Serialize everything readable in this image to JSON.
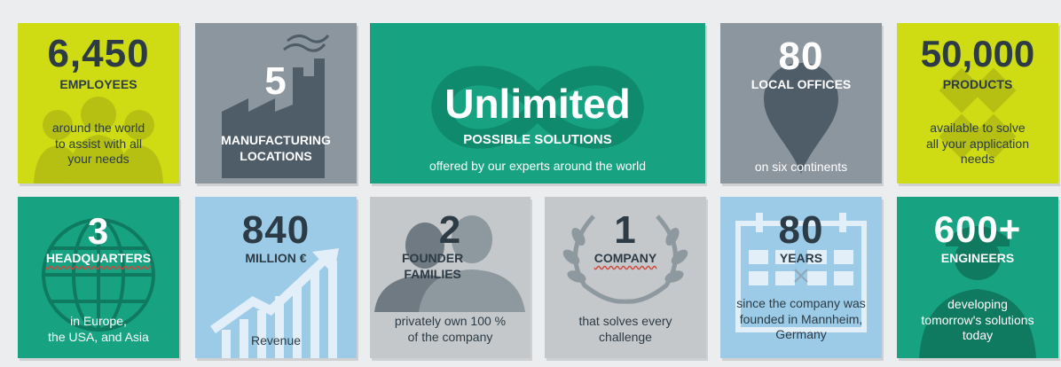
{
  "tiles": {
    "employees": {
      "number": "6,450",
      "label": "EMPLOYEES",
      "desc": [
        "around the world",
        "to assist with all",
        "your needs"
      ]
    },
    "manufacturing": {
      "number": "5",
      "label": [
        "MANUFACTURING",
        "LOCATIONS"
      ]
    },
    "unlimited": {
      "number": "Unlimited",
      "label": "POSSIBLE SOLUTIONS",
      "desc": "offered by our experts around the world"
    },
    "offices": {
      "number": "80",
      "label": "LOCAL OFFICES",
      "desc": "on six continents"
    },
    "products": {
      "number": "50,000",
      "label": "PRODUCTS",
      "desc": [
        "available to solve",
        "all your application",
        "needs"
      ]
    },
    "headquarters": {
      "number": "3",
      "label": "HEADQUARTERS",
      "desc": [
        "in Europe,",
        "the USA, and Asia"
      ]
    },
    "revenue": {
      "number": "840",
      "label": "MILLION €",
      "desc": "Revenue"
    },
    "families": {
      "number": "2",
      "label": [
        "FOUNDER",
        "FAMILIES"
      ],
      "desc": [
        "privately own 100 %",
        "of the company"
      ]
    },
    "company": {
      "number": "1",
      "label": "COMPANY",
      "desc": [
        "that solves every",
        "challenge"
      ]
    },
    "years": {
      "number": "80",
      "label": "YEARS",
      "desc": [
        "since the company was",
        "founded in Mannheim,",
        "Germany"
      ]
    },
    "engineers": {
      "number": "600+",
      "label": "ENGINEERS",
      "desc": [
        "developing",
        "tomorrow's solutions",
        "today"
      ]
    }
  },
  "colors": {
    "lime": "#cfdc13",
    "slate": "#8c969f",
    "teal": "#17a382",
    "sky": "#9ccbe8",
    "grey": "#c5c8cb",
    "dark_text": "#2c3b45",
    "page_background": "#ebedee"
  },
  "icons": {
    "employees": "people-group-icon",
    "manufacturing": "factory-icon",
    "unlimited": "infinity-icon",
    "offices": "map-pin-icon",
    "products": "puzzle-pieces-icon",
    "headquarters": "globe-icon",
    "revenue": "growth-chart-icon",
    "families": "family-silhouette-icon",
    "company": "laurel-wreath-icon",
    "years": "calendar-icon",
    "engineers": "engineer-silhouette-icon"
  }
}
